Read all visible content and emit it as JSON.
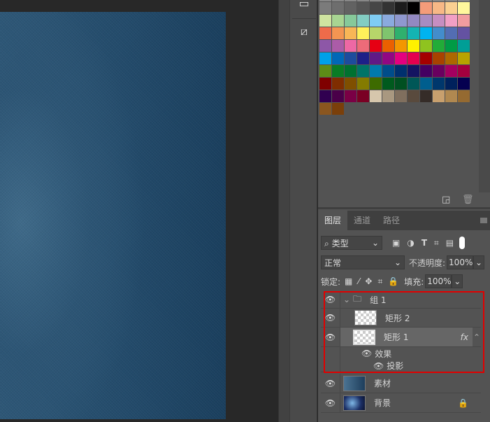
{
  "swatches": {
    "rows": [
      [
        "#7b7b7b",
        "#6e6e6e",
        "#626262",
        "#555555",
        "#464646",
        "#333333",
        "#1c1c1c",
        "#000000",
        "#f49c7a",
        "#f7b886",
        "#fad091",
        "#fff79c"
      ],
      [
        "#cfe4a0",
        "#a8d592",
        "#86c99a",
        "#83cdc3",
        "#7fccf3",
        "#8aaade",
        "#8f98cf",
        "#9289c1",
        "#a88cc2",
        "#c78ec1",
        "#f29fc5",
        "#f19ca0"
      ],
      [
        "#ee6b4a",
        "#f39552",
        "#f8b656",
        "#fff05a",
        "#b7d56a",
        "#7fc46e",
        "#2fb06e",
        "#14b4b3",
        "#00b3ef",
        "#438dcc",
        "#536db3",
        "#6452a2"
      ],
      [
        "#8d57a7",
        "#ab5ca8",
        "#ee68a4",
        "#ed6b79",
        "#e60013",
        "#eb6000",
        "#f39700",
        "#fff100",
        "#8fc31f",
        "#22ac38",
        "#009b45",
        "#009e96"
      ],
      [
        "#00a0e9",
        "#0068b7",
        "#1d4c9d",
        "#1d2088",
        "#601986",
        "#920783",
        "#e4007f",
        "#e5004f",
        "#a40000",
        "#a84200",
        "#ad6800",
        "#b7a300"
      ],
      [
        "#5d8c17",
        "#097c25",
        "#007130",
        "#007467",
        "#007aad",
        "#004d8a",
        "#00306e",
        "#141461",
        "#440062",
        "#6a005f",
        "#a40060",
        "#a4003f"
      ],
      [
        "#7f0000",
        "#7f2d00",
        "#7f4f00",
        "#847b00",
        "#3d6b00",
        "#005a1e",
        "#005021",
        "#005757",
        "#005e8e",
        "#00376c",
        "#00215c",
        "#050050"
      ],
      [
        "#300050",
        "#4a0049",
        "#7a0045",
        "#7a0024",
        "#d6c6ac",
        "#a99880",
        "#806f5e",
        "#594a3d",
        "#352c28",
        "#c8a06e",
        "#b08850",
        "#956a31"
      ],
      [
        "#8a561f",
        "#7a3f0a"
      ]
    ]
  },
  "layers_panel": {
    "tabs": [
      "图层",
      "通道",
      "路径"
    ],
    "filter_kind": "类型",
    "blend_mode": "正常",
    "opacity_label": "不透明度:",
    "opacity": "100%",
    "lock_label": "锁定:",
    "fill_label": "填充:",
    "fill": "100%",
    "layers": [
      {
        "name": "组 1",
        "type": "group"
      },
      {
        "name": "矩形 2",
        "type": "shape"
      },
      {
        "name": "矩形 1",
        "type": "shape",
        "selected": true,
        "fx": "fx"
      },
      {
        "name": "效果",
        "type": "effects"
      },
      {
        "name": "投影",
        "type": "effect"
      },
      {
        "name": "素材",
        "type": "smart-object"
      },
      {
        "name": "背景",
        "type": "background",
        "locked": true
      }
    ]
  },
  "highlight_color": "#e00000"
}
